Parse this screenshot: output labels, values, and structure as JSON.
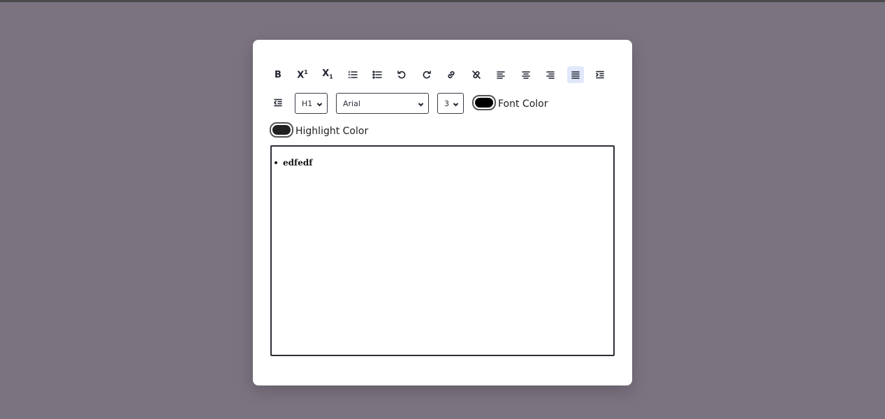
{
  "page": {
    "background": "#7b7380",
    "card_background": "#ffffff"
  },
  "toolbar": {
    "buttons": [
      {
        "name": "bold",
        "glyph": "B",
        "icon": "bold-icon",
        "active": false
      },
      {
        "name": "superscript",
        "glyph": "X¹",
        "icon": "superscript-icon",
        "active": false
      },
      {
        "name": "subscript",
        "glyph": "X₁",
        "icon": "subscript-icon",
        "active": false
      },
      {
        "name": "ordered-list",
        "icon": "ordered-list-icon",
        "active": false
      },
      {
        "name": "unordered-list",
        "icon": "unordered-list-icon",
        "active": false
      },
      {
        "name": "undo",
        "icon": "undo-icon",
        "active": false
      },
      {
        "name": "redo",
        "icon": "redo-icon",
        "active": false
      },
      {
        "name": "link",
        "icon": "link-icon",
        "active": false
      },
      {
        "name": "unlink",
        "icon": "unlink-icon",
        "active": false
      },
      {
        "name": "align-left",
        "icon": "align-left-icon",
        "active": false
      },
      {
        "name": "align-center",
        "icon": "align-center-icon",
        "active": false
      },
      {
        "name": "align-right",
        "icon": "align-right-icon",
        "active": false
      },
      {
        "name": "justify",
        "icon": "justify-icon",
        "active": true
      },
      {
        "name": "indent",
        "icon": "indent-icon",
        "active": false
      },
      {
        "name": "outdent",
        "icon": "outdent-icon",
        "active": false
      }
    ],
    "heading_select": {
      "value": "H1"
    },
    "font_select": {
      "value": "Arial"
    },
    "size_select": {
      "value": "3"
    },
    "font_color": {
      "label": "Font Color",
      "value": "#000000"
    },
    "highlight_color": {
      "label": "Highlight Color",
      "value": "#222222"
    }
  },
  "editor": {
    "content": [
      "edfedf"
    ]
  },
  "colors": {
    "active_button_bg": "#e1e7fb",
    "editor_border": "#2d2f36"
  }
}
